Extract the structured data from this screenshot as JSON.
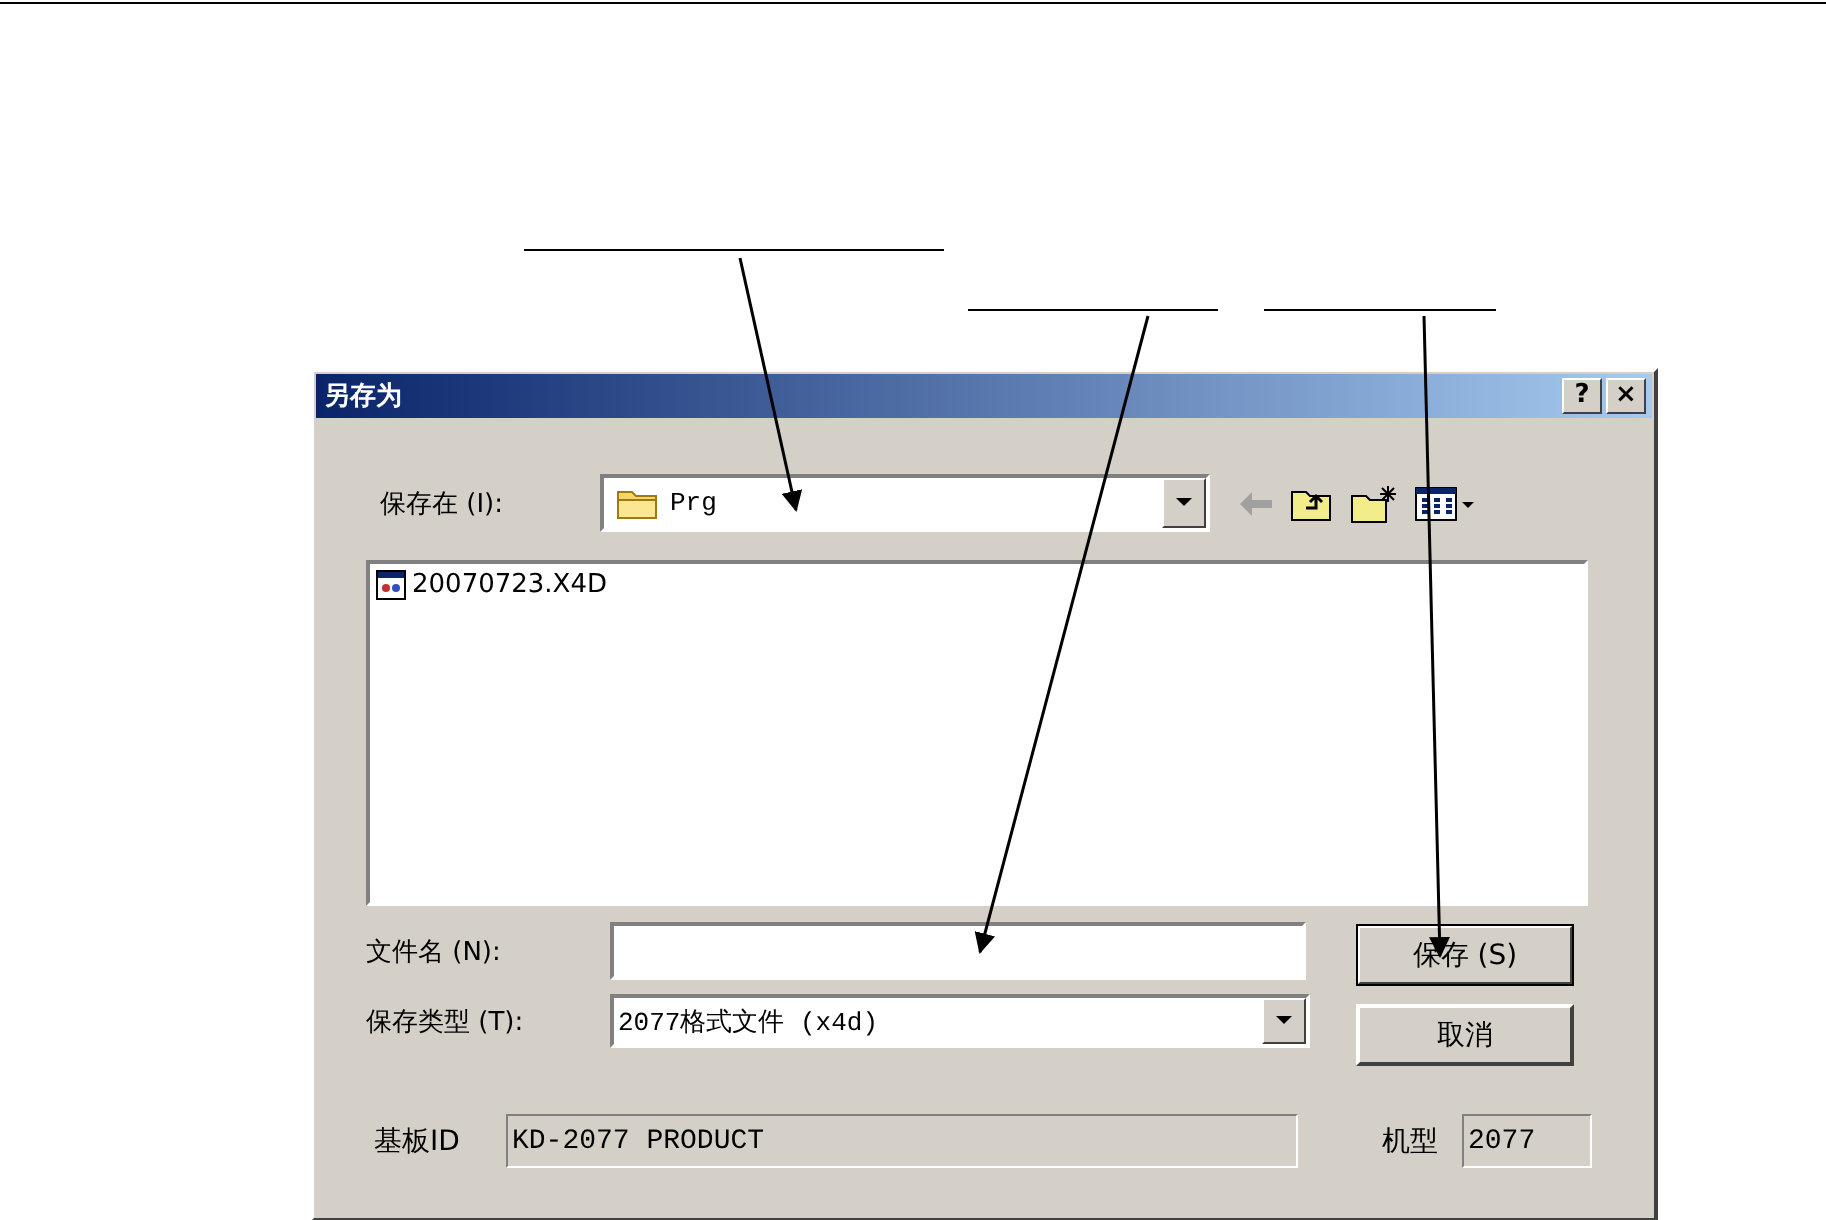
{
  "dialog": {
    "title": "另存为",
    "title_buttons": [
      "?",
      "×"
    ],
    "save_in": {
      "label": "保存在 (I):",
      "value": "Prg"
    },
    "files": [
      {
        "name": "20070723.X4D"
      }
    ],
    "file_name": {
      "label": "文件名 (N):"
    },
    "file_type": {
      "label": "保存类型 (T):",
      "value": "2077格式文件 (x4d)"
    },
    "buttons": [
      {
        "label": "保存 (S)",
        "default": true
      },
      {
        "label": "取消",
        "default": false
      }
    ],
    "board_id": {
      "label": "基板ID",
      "value": "KD-2077 PRODUCT"
    },
    "model": {
      "label": "机型",
      "value": "2077"
    }
  }
}
